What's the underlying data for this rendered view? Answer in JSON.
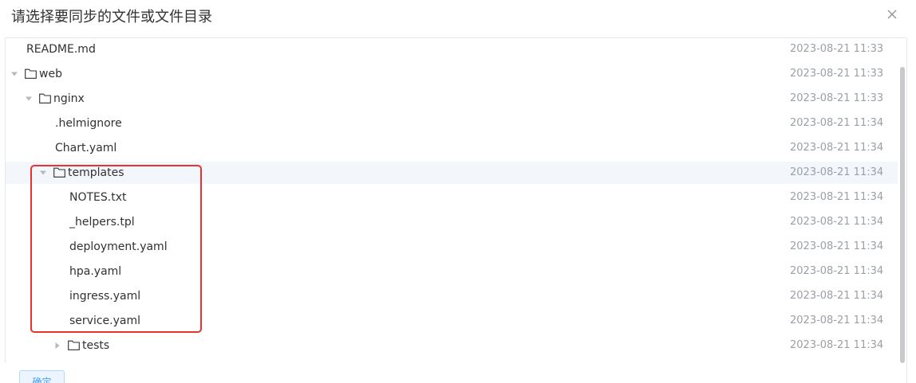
{
  "dialog": {
    "title": "请选择要同步的文件或文件目录",
    "confirm_label": "确定"
  },
  "tree": [
    {
      "label": "README.md",
      "time": "2023-08-21 11:33"
    },
    {
      "label": "web",
      "time": "2023-08-21 11:33"
    },
    {
      "label": "nginx",
      "time": "2023-08-21 11:33"
    },
    {
      "label": ".helmignore",
      "time": "2023-08-21 11:34"
    },
    {
      "label": "Chart.yaml",
      "time": "2023-08-21 11:34"
    },
    {
      "label": "templates",
      "time": "2023-08-21 11:34"
    },
    {
      "label": "NOTES.txt",
      "time": "2023-08-21 11:34"
    },
    {
      "label": "_helpers.tpl",
      "time": "2023-08-21 11:34"
    },
    {
      "label": "deployment.yaml",
      "time": "2023-08-21 11:34"
    },
    {
      "label": "hpa.yaml",
      "time": "2023-08-21 11:34"
    },
    {
      "label": "ingress.yaml",
      "time": "2023-08-21 11:34"
    },
    {
      "label": "service.yaml",
      "time": "2023-08-21 11:34"
    },
    {
      "label": "tests",
      "time": "2023-08-21 11:34"
    }
  ],
  "icons": {
    "close": "close-icon",
    "expanded": "caret-down-icon",
    "collapsed": "caret-right-icon",
    "folder": "folder-icon"
  },
  "colors": {
    "accent": "#409eff",
    "highlight_border": "#e8322d",
    "row_highlight": "#f3f6fb"
  }
}
